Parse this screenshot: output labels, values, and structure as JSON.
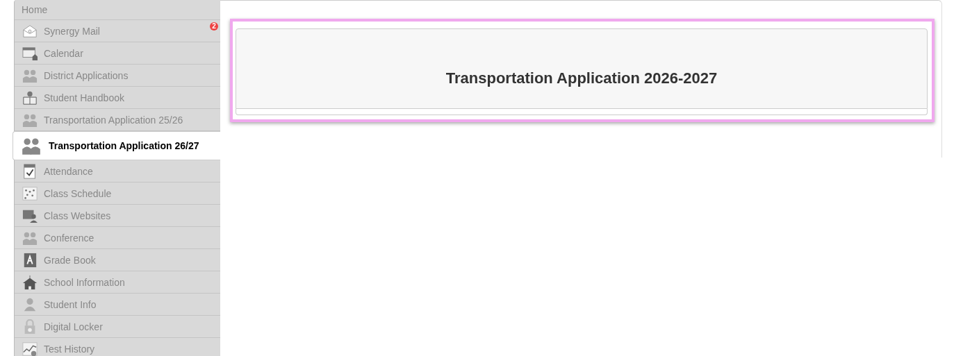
{
  "sidebar": {
    "header": "Home",
    "items": [
      {
        "label": "Synergy Mail",
        "selected": false,
        "badge": "2"
      },
      {
        "label": "Calendar",
        "selected": false
      },
      {
        "label": "District Applications",
        "selected": false
      },
      {
        "label": "Student Handbook",
        "selected": false
      },
      {
        "label": "Transportation Application 25/26",
        "selected": false
      },
      {
        "label": "Transportation Application 26/27",
        "selected": true
      },
      {
        "label": "Attendance",
        "selected": false
      },
      {
        "label": "Class Schedule",
        "selected": false
      },
      {
        "label": "Class Websites",
        "selected": false
      },
      {
        "label": "Conference",
        "selected": false
      },
      {
        "label": "Grade Book",
        "selected": false
      },
      {
        "label": "School Information",
        "selected": false
      },
      {
        "label": "Student Info",
        "selected": false
      },
      {
        "label": "Digital Locker",
        "selected": false
      },
      {
        "label": "Test History",
        "selected": false
      }
    ]
  },
  "main": {
    "title": "Transportation Application 2026-2027"
  }
}
